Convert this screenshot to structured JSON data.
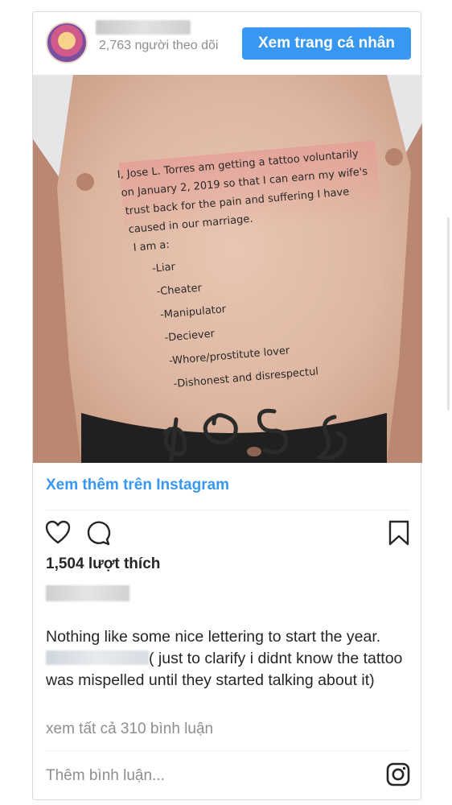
{
  "header": {
    "followers_text": "2,763 người theo dõi",
    "profile_button": "Xem trang cá nhân"
  },
  "photo": {
    "tattoo_lines": [
      "I, Jose L. Torres  am getting a tattoo voluntarily",
      "on January 2, 2019 so that I can earn my wife's",
      "trust back for the pain and suffering I have",
      "caused in our marriage.",
      "I am a:",
      "-Liar",
      "-Cheater",
      "-Manipulator",
      "-Deciever",
      "-Whore/prostitute lover",
      "-Dishonest and disrespectul"
    ]
  },
  "see_more_link": "Xem thêm trên Instagram",
  "likes": "1,504 lượt thích",
  "caption": {
    "before": "Nothing like some nice lettering to start the year.",
    "after": "( just to clarify i didnt know the tattoo was mispelled until they started talking about it)"
  },
  "view_comments": "xem tất cả 310 bình luận",
  "add_comment_placeholder": "Thêm bình luận...",
  "icons": {
    "like": "heart-icon",
    "comment": "comment-icon",
    "save": "bookmark-icon",
    "brand": "instagram-icon"
  },
  "colors": {
    "accent": "#3897f0",
    "muted": "#8e8e8e",
    "border": "#dbdbdb"
  }
}
